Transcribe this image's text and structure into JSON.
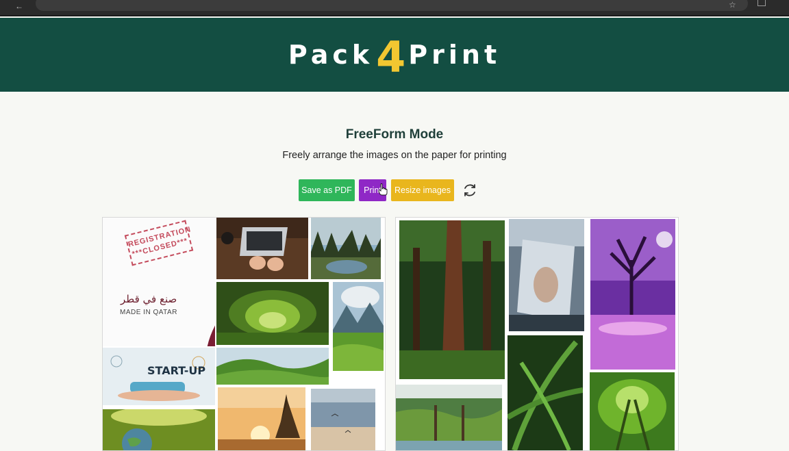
{
  "header": {
    "logo_part1": "Pack",
    "logo_number": "4",
    "logo_part2": "Print"
  },
  "main": {
    "title": "FreeForm Mode",
    "subtitle": "Freely arrange the images on the paper for printing"
  },
  "toolbar": {
    "save_pdf_label": "Save as PDF",
    "print_label": "Print",
    "resize_label": "Resize images",
    "refresh_icon": "refresh-icon"
  },
  "images": {
    "stamp_line1": "REGISTRATION",
    "stamp_line2": "***CLOSED***",
    "qatar_arabic": "صنع في قطر",
    "qatar_english": "MADE IN QATAR",
    "startup": "START-UP"
  },
  "colors": {
    "header_bg": "#134e42",
    "logo_accent": "#f2c731",
    "save_pdf": "#2fb65a",
    "print": "#8f28c6",
    "resize": "#e9b61d"
  }
}
